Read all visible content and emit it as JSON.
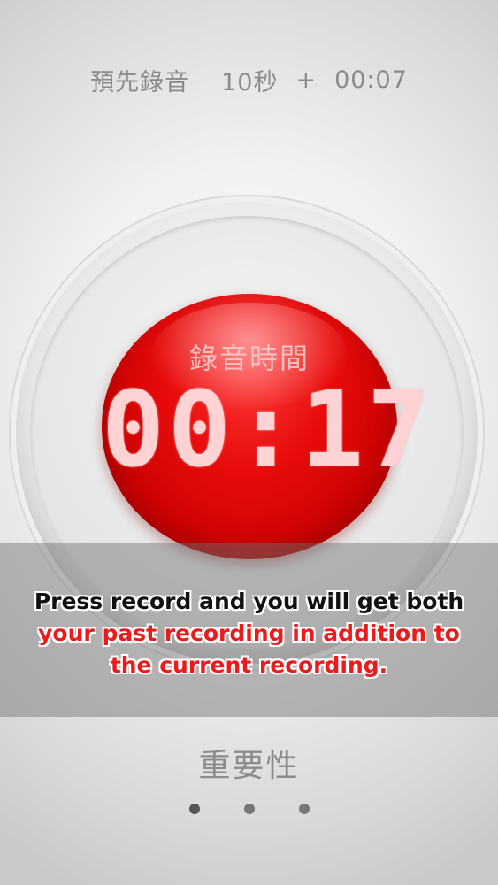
{
  "header": {
    "pre_record_label": "預先錄音",
    "pre_record_seconds": "10秒",
    "plus": "+",
    "elapsed": "00:07"
  },
  "recorder": {
    "label": "錄音時間",
    "time": "00:17"
  },
  "tutorial": {
    "line1": "Press record and you will get both",
    "line2": "your past recording in addition to",
    "line3": "the current recording."
  },
  "page_title": "重要性",
  "pager": {
    "count": 3,
    "active_index": 0
  },
  "colors": {
    "record_red": "#e80b0b",
    "tip_red": "#ec1b1b",
    "timer_digits": "#ffd3d3"
  }
}
